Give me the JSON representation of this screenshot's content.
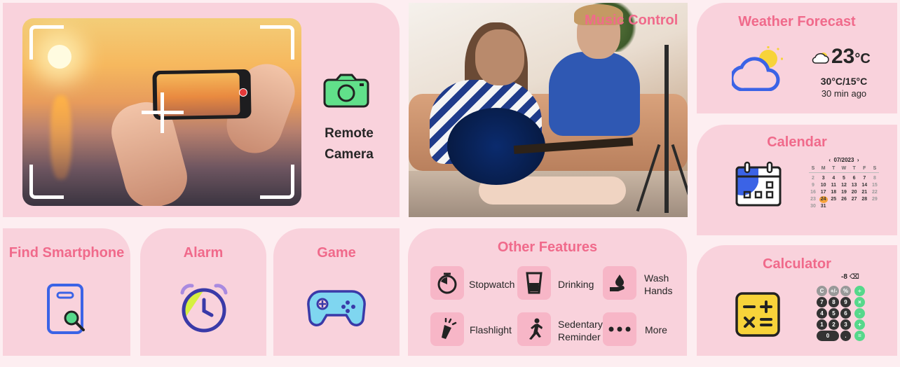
{
  "remote_camera": {
    "line1": "Remote",
    "line2": "Camera"
  },
  "music_control": {
    "title": "Music Control"
  },
  "weather": {
    "title": "Weather Forecast",
    "temp": "23",
    "unit": "°C",
    "range": "30°C/15°C",
    "updated": "30 min ago"
  },
  "calendar": {
    "title": "Calendar",
    "month": "07/2023",
    "weekdays": [
      "S",
      "M",
      "T",
      "W",
      "T",
      "F",
      "S"
    ],
    "weeks": [
      [
        "2",
        "3",
        "4",
        "5",
        "6",
        "7",
        "8"
      ],
      [
        "9",
        "10",
        "11",
        "12",
        "13",
        "14",
        "15"
      ],
      [
        "16",
        "17",
        "18",
        "19",
        "20",
        "21",
        "22"
      ],
      [
        "23",
        "24",
        "25",
        "26",
        "27",
        "28",
        "29"
      ],
      [
        "30",
        "31",
        "",
        "",
        "",
        "",
        ""
      ]
    ],
    "highlighted_day": "24"
  },
  "find_smartphone": {
    "title": "Find Smartphone"
  },
  "alarm": {
    "title": "Alarm"
  },
  "game": {
    "title": "Game"
  },
  "other_features": {
    "title": "Other Features",
    "stopwatch": "Stopwatch",
    "drinking": "Drinking",
    "wash_hands_1": "Wash",
    "wash_hands_2": "Hands",
    "flashlight": "Flashlight",
    "sedentary_1": "Sedentary",
    "sedentary_2": "Reminder",
    "more": "More"
  },
  "calculator": {
    "title": "Calculator",
    "display": "-8",
    "keys_row1": [
      "C",
      "+/-",
      "%",
      "÷"
    ],
    "keys_row2": [
      "7",
      "8",
      "9",
      "×"
    ],
    "keys_row3": [
      "4",
      "5",
      "6",
      "-"
    ],
    "keys_row4": [
      "1",
      "2",
      "3",
      "+"
    ],
    "keys_row5": [
      "0",
      ".",
      "="
    ]
  },
  "colors": {
    "accent": "#f06a8b",
    "card": "#f9d2dc",
    "tile": "#f7b6c7",
    "blue": "#3b63e6",
    "green": "#56d88b"
  }
}
